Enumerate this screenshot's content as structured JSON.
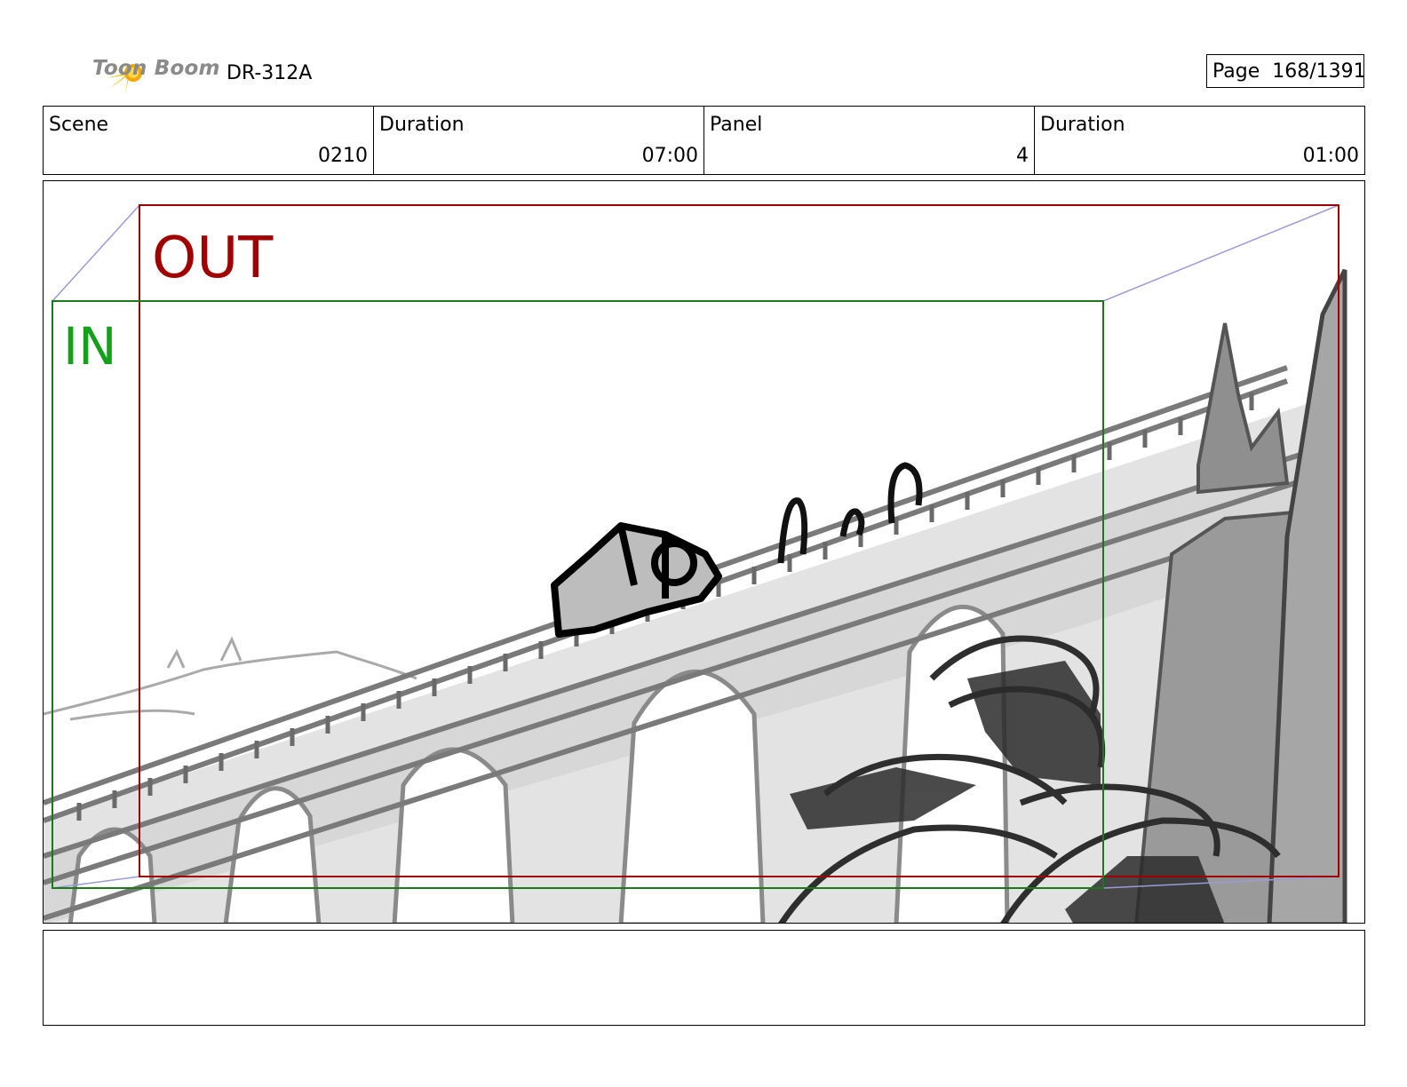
{
  "header": {
    "logo_text": "Toon Boom",
    "project": "DR-312A",
    "page_label": "Page",
    "page_value": "168/1391"
  },
  "info": {
    "scene_label": "Scene",
    "scene_value": "0210",
    "scene_duration_label": "Duration",
    "scene_duration_value": "07:00",
    "panel_label": "Panel",
    "panel_value": "4",
    "panel_duration_label": "Duration",
    "panel_duration_value": "01:00"
  },
  "panel": {
    "out_label": "OUT",
    "in_label": "IN",
    "out_color": "#a00000",
    "in_color": "#13a01c"
  },
  "notes": {
    "text": ""
  }
}
